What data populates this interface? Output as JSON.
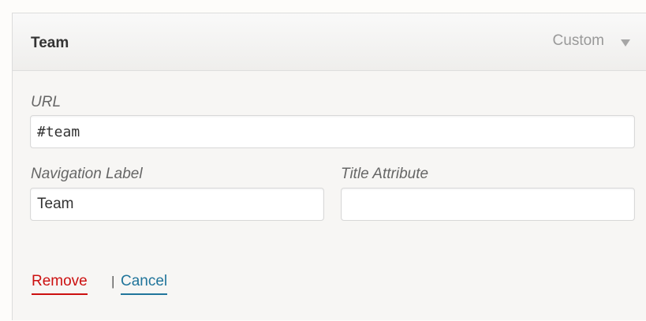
{
  "menu_item": {
    "title": "Team",
    "type_label": "Custom",
    "toggle_icon": "triangle-down-icon"
  },
  "fields": {
    "url": {
      "label": "URL",
      "value": "#team"
    },
    "navigation_label": {
      "label": "Navigation Label",
      "value": "Team"
    },
    "title_attribute": {
      "label": "Title Attribute",
      "value": ""
    }
  },
  "actions": {
    "remove_label": "Remove",
    "separator": "|",
    "cancel_label": "Cancel"
  },
  "colors": {
    "remove": "#cc1010",
    "cancel": "#21759b",
    "label": "#666666"
  }
}
